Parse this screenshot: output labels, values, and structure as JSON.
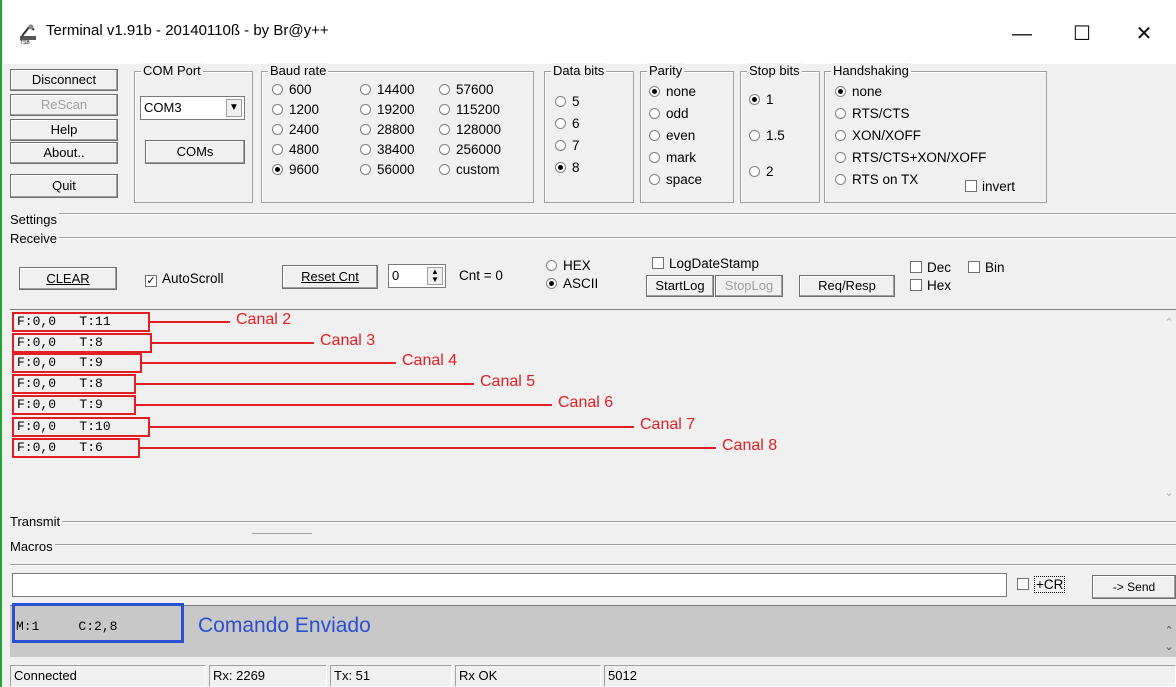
{
  "window": {
    "title": "Terminal v1.91b - 20140110ß - by Br@y++",
    "minimize": "—",
    "maximize": "☐",
    "close": "✕"
  },
  "buttons": {
    "disconnect": "Disconnect",
    "rescan": "ReScan",
    "help": "Help",
    "about": "About..",
    "quit": "Quit",
    "coms": "COMs"
  },
  "com_port": {
    "label": "COM Port",
    "value": "COM3"
  },
  "baud": {
    "label": "Baud rate",
    "options": [
      "600",
      "1200",
      "2400",
      "4800",
      "9600",
      "14400",
      "19200",
      "28800",
      "38400",
      "56000",
      "57600",
      "115200",
      "128000",
      "256000",
      "custom"
    ],
    "selected": "9600"
  },
  "data_bits": {
    "label": "Data bits",
    "options": [
      "5",
      "6",
      "7",
      "8"
    ],
    "selected": "8"
  },
  "parity": {
    "label": "Parity",
    "options": [
      "none",
      "odd",
      "even",
      "mark",
      "space"
    ],
    "selected": "none"
  },
  "stop_bits": {
    "label": "Stop bits",
    "options": [
      "1",
      "1.5",
      "2"
    ],
    "selected": "1"
  },
  "handshaking": {
    "label": "Handshaking",
    "options": [
      "none",
      "RTS/CTS",
      "XON/XOFF",
      "RTS/CTS+XON/XOFF",
      "RTS on TX"
    ],
    "selected": "none",
    "invert": "invert"
  },
  "sections": {
    "settings": "Settings",
    "receive": "Receive",
    "transmit": "Transmit",
    "macros": "Macros"
  },
  "receive": {
    "clear": "CLEAR",
    "autoscroll": "AutoScroll",
    "reset_cnt": "Reset Cnt",
    "cnt_value": "0",
    "cnt_label": "Cnt = 0",
    "hex": "HEX",
    "ascii": "ASCII",
    "logdatestamp": "LogDateStamp",
    "startlog": "StartLog",
    "stoplog": "StopLog",
    "reqresp": "Req/Resp",
    "dec": "Dec",
    "bin": "Bin",
    "hex2": "Hex"
  },
  "rx_lines": [
    "F:0,0   T:11",
    "F:0,0   T:8",
    "F:0,0   T:9",
    "F:0,0   T:8",
    "F:0,0   T:9",
    "F:0,0   T:10",
    "F:0,0   T:6"
  ],
  "annotations": [
    "Canal 2",
    "Canal 3",
    "Canal 4",
    "Canal 5",
    "Canal 6",
    "Canal 7",
    "Canal 8"
  ],
  "transmit": {
    "cr": "+CR",
    "send": "-> Send",
    "input_value": ""
  },
  "tx_line": "M:1     C:2,8",
  "tx_annotation": "Comando Enviado",
  "status": {
    "state": "Connected",
    "rx": "Rx: 2269",
    "tx": "Tx: 51",
    "rx_ok": "Rx OK",
    "num": "5012"
  },
  "colors": {
    "annotation_red": "#e31e24",
    "annotation_blue": "#2b4fd1",
    "border_green": "#21a336"
  }
}
